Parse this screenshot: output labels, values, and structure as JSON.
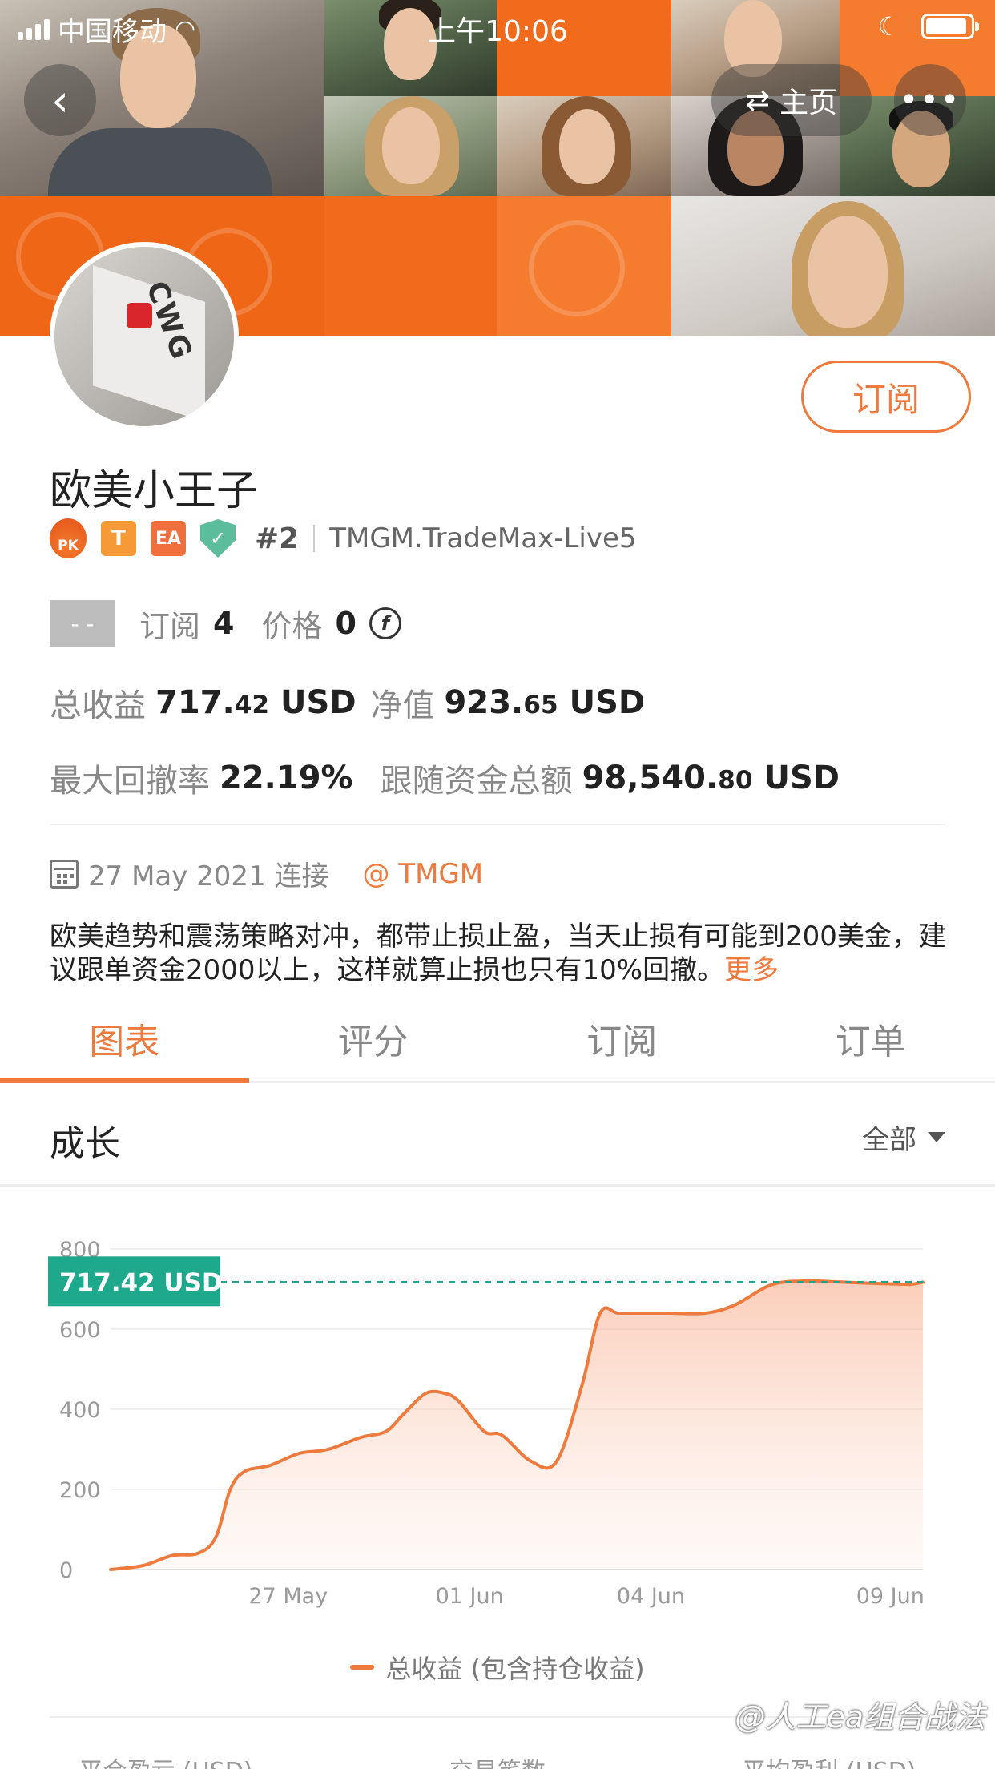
{
  "status_bar": {
    "carrier": "中国移动",
    "time": "上午10:06"
  },
  "nav": {
    "back_icon": "‹",
    "home_label": "主页",
    "home_icon": "⇄",
    "more_icon": "•••"
  },
  "avatar_logo": "CWG",
  "profile": {
    "subscribe_label": "订阅",
    "name": "欧美小王子",
    "badges": {
      "pk": "PK",
      "t": "T",
      "ea": "EA",
      "shield": "✓"
    },
    "rank": "#2",
    "server": "TMGM.TradeMax-Live5"
  },
  "stats": {
    "placeholder": "- -",
    "subscribe_label": "订阅",
    "subscribe_count": "4",
    "price_label": "价格",
    "price_value": "0",
    "coin_symbol": "f",
    "total_profit_label": "总收益",
    "total_profit_int": "717.",
    "total_profit_dec": "42",
    "total_profit_unit": "USD",
    "equity_label": "净值",
    "equity_int": "923.",
    "equity_dec": "65",
    "equity_unit": "USD",
    "drawdown_label": "最大回撤率",
    "drawdown_value": "22.19%",
    "follow_label": "跟随资金总额",
    "follow_int": "98,540.",
    "follow_dec": "80",
    "follow_unit": "USD"
  },
  "connect": {
    "date": "27 May 2021 连接",
    "broker": "@ TMGM"
  },
  "description": {
    "text": "欧美趋势和震荡策略对冲，都带止损止盈，当天止损有可能到200美金，建议跟单资金2000以上，这样就算止损也只有10%回撤。",
    "more": "更多"
  },
  "tabs": [
    "图表",
    "评分",
    "订阅",
    "订单"
  ],
  "section": {
    "title": "成长",
    "filter": "全部"
  },
  "chart_data": {
    "type": "area",
    "title": "",
    "xlabel": "",
    "ylabel": "",
    "ylim": [
      0,
      800
    ],
    "yticks": [
      0,
      200,
      400,
      600,
      800
    ],
    "xticks": [
      {
        "label": "27 May",
        "day": 2.5
      },
      {
        "label": "01 Jun",
        "day": 7.5
      },
      {
        "label": "04 Jun",
        "day": 12.5
      },
      {
        "label": "09 Jun",
        "day": 19.1
      }
    ],
    "current_label": "717.42 USD",
    "current_value": 717.42,
    "series": [
      {
        "name": "总收益 (包含持仓收益)",
        "color": "#ef7a3d",
        "x": [
          -2.4,
          -1.5,
          -0.7,
          0.0,
          0.5,
          0.9,
          1.3,
          2.0,
          2.8,
          3.6,
          4.5,
          5.2,
          5.7,
          6.3,
          6.8,
          7.2,
          7.9,
          8.4,
          9.2,
          9.9,
          10.6,
          11.1,
          11.6,
          12.3,
          13.0,
          14.0,
          14.8,
          15.8,
          16.7,
          17.6,
          18.4,
          19.5,
          19.7,
          20.0
        ],
        "y": [
          0,
          10,
          35,
          40,
          80,
          200,
          245,
          260,
          290,
          300,
          330,
          345,
          390,
          440,
          440,
          420,
          345,
          335,
          270,
          270,
          460,
          640,
          640,
          640,
          640,
          640,
          660,
          710,
          720,
          718,
          715,
          712,
          712,
          717
        ]
      }
    ]
  },
  "bottom_labels": [
    "平合盈亏 (USD)",
    "交易笔数",
    "平均盈利 (USD)"
  ],
  "watermark": "@人工ea组合战法"
}
